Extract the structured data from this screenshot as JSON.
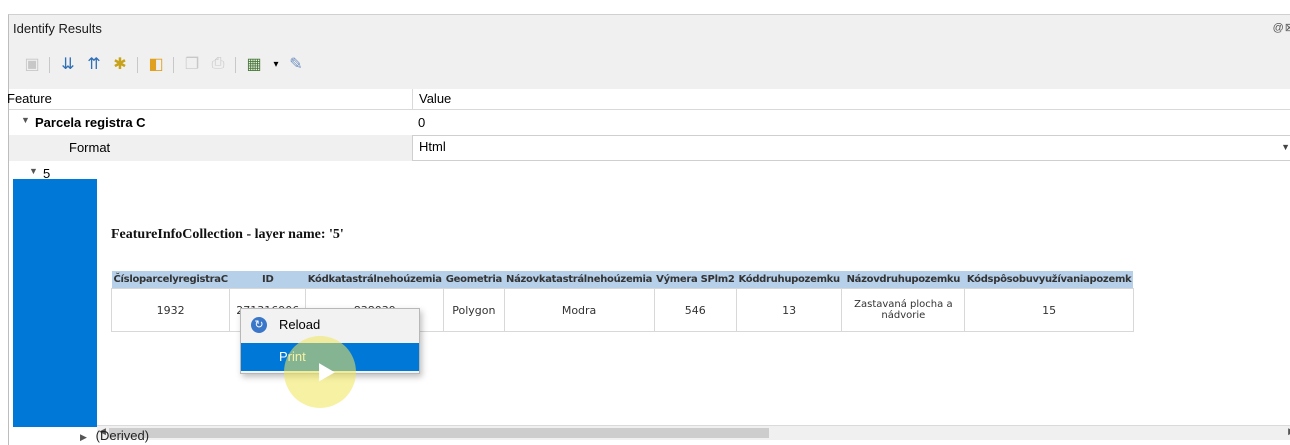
{
  "window": {
    "title": "Identify Results",
    "controls": "@⊠"
  },
  "toolbar": {
    "icons": [
      "expand-icon",
      "expand-tree-icon",
      "collapse-tree-icon",
      "expand-new-icon",
      "clear-results-icon",
      "copy-icon",
      "print-icon",
      "select-features-icon",
      "help-icon"
    ]
  },
  "tree": {
    "header": {
      "feature": "Feature",
      "value": "Value"
    },
    "layer": {
      "name": "Parcela registra C",
      "value": "0"
    },
    "format": {
      "label": "Format",
      "value": "Html"
    },
    "node": {
      "label": "5"
    },
    "derived": {
      "label": "(Derived)"
    }
  },
  "html_view": {
    "heading": "FeatureInfoCollection - layer name: '5'",
    "columns": [
      "ČísloparcelyregistraC",
      "ID",
      "Kódkatastrálnehoúzemia",
      "Geometria",
      "Názovkatastrálnehoúzemia",
      "Výmera SPlm2",
      "Kóddruhupozemku",
      "Názovdruhupozemku",
      "Kódspôsobuvyužívaniapozemk"
    ],
    "row": [
      "1932",
      "271316906",
      "838039",
      "Polygon",
      "Modra",
      "546",
      "13",
      "Zastavaná plocha a nádvorie",
      "15"
    ]
  },
  "context_menu": {
    "items": [
      {
        "label": "Reload",
        "icon": "reload-icon"
      },
      {
        "label": "Print",
        "selected": true
      }
    ]
  },
  "colors": {
    "accent": "#0078d7",
    "table_header": "#b6d0ea",
    "highlight": "#f0e65a"
  }
}
